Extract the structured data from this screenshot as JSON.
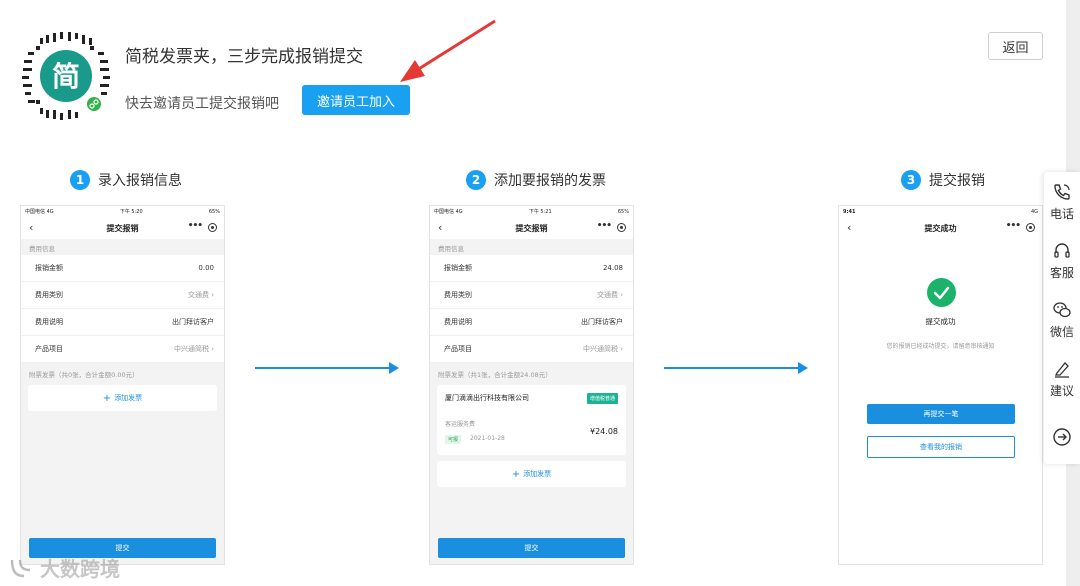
{
  "header": {
    "title": "简税发票夹，三步完成报销提交",
    "subtitle": "快去邀请员工提交报销吧",
    "invite_button": "邀请员工加入",
    "back_button": "返回",
    "accent_color": "#1aa0f0",
    "arrow_color": "#e53935"
  },
  "steps": [
    {
      "num": "1",
      "label": "录入报销信息"
    },
    {
      "num": "2",
      "label": "添加要报销的发票"
    },
    {
      "num": "3",
      "label": "提交报销"
    }
  ],
  "phone1": {
    "status_left": "中国电信 4G",
    "status_time": "下午 5:20",
    "status_right": "65%",
    "title": "提交报销",
    "section_label": "费用信息",
    "rows": [
      {
        "label": "报销金额",
        "value": "0.00"
      },
      {
        "label": "费用类别",
        "value": "交通费"
      },
      {
        "label": "费用说明",
        "value": "出门拜访客户"
      },
      {
        "label": "产品项目",
        "value": "中兴通简税"
      }
    ],
    "attach_label": "附票发票（共0张，合计金额0.00元）",
    "add_invoice": "添加发票",
    "submit": "提交"
  },
  "phone2": {
    "status_left": "中国电信 4G",
    "status_time": "下午 5:21",
    "status_right": "65%",
    "title": "提交报销",
    "section_label": "费用信息",
    "rows": [
      {
        "label": "报销金额",
        "value": "24.08"
      },
      {
        "label": "费用类别",
        "value": "交通费"
      },
      {
        "label": "费用说明",
        "value": "出门拜访客户"
      },
      {
        "label": "产品项目",
        "value": "中兴通简税"
      }
    ],
    "attach_label": "附票发票（共1张，合计金额24.08元）",
    "invoice": {
      "company": "厦门滴滴出行科技有限公司",
      "tag": "增值税普通",
      "type": "客运服务费",
      "badge": "可报",
      "date": "2021-01-28",
      "amount": "¥24.08"
    },
    "add_invoice": "添加发票",
    "submit": "提交"
  },
  "phone3": {
    "status_time": "9:41",
    "status_right": "4G",
    "title": "提交成功",
    "success_title": "提交成功",
    "success_desc": "您的报销已经成功提交，请留意审核通知",
    "again_button": "再提交一笔",
    "view_button": "查看我的报销",
    "success_color": "#1bb36a"
  },
  "sidebar": {
    "items": [
      {
        "label": "电话",
        "icon": "phone-icon"
      },
      {
        "label": "客服",
        "icon": "headset-icon"
      },
      {
        "label": "微信",
        "icon": "wechat-icon"
      },
      {
        "label": "建议",
        "icon": "pen-icon"
      },
      {
        "label": "",
        "icon": "arrow-right-circle-icon"
      }
    ]
  },
  "watermark": {
    "text": "大数跨境"
  }
}
